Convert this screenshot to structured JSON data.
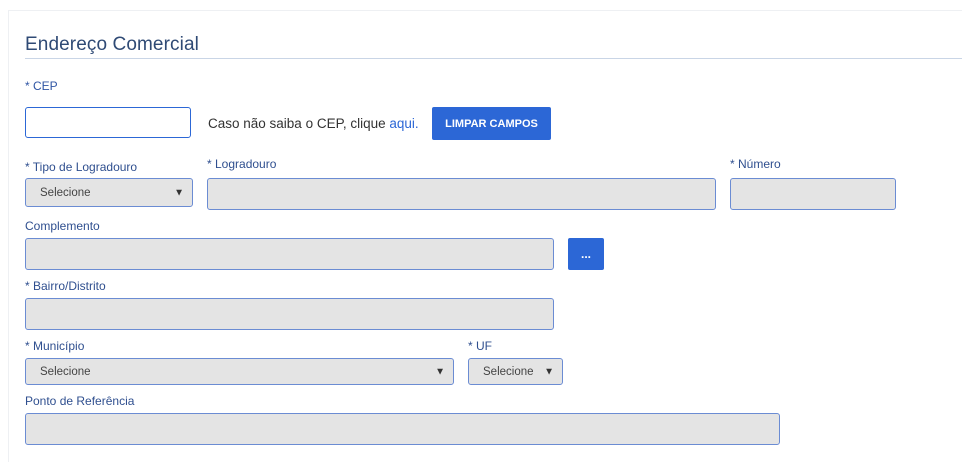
{
  "section": {
    "title": "Endereço Comercial"
  },
  "cep": {
    "label": "* CEP",
    "value": "",
    "hint_text": "Caso não saiba o CEP, clique ",
    "hint_link": "aqui.",
    "clear_button": "LIMPAR CAMPOS"
  },
  "tipo_logradouro": {
    "label": "* Tipo de Logradouro",
    "selected": "Selecione",
    "arrow_icon": "▼"
  },
  "logradouro": {
    "label": "* Logradouro",
    "value": ""
  },
  "numero": {
    "label": "* Número",
    "value": ""
  },
  "complemento": {
    "label": "Complemento",
    "value": "",
    "more_button": "..."
  },
  "bairro": {
    "label": "* Bairro/Distrito",
    "value": ""
  },
  "municipio": {
    "label": "* Município",
    "selected": "Selecione",
    "arrow_icon": "▼"
  },
  "uf": {
    "label": "* UF",
    "selected": "Selecione",
    "arrow_icon": "▼"
  },
  "ponto_referencia": {
    "label": "Ponto de Referência",
    "value": ""
  },
  "colors": {
    "accent": "#2c67d6",
    "label": "#2f55a4",
    "field_bg": "#e4e4e4"
  }
}
